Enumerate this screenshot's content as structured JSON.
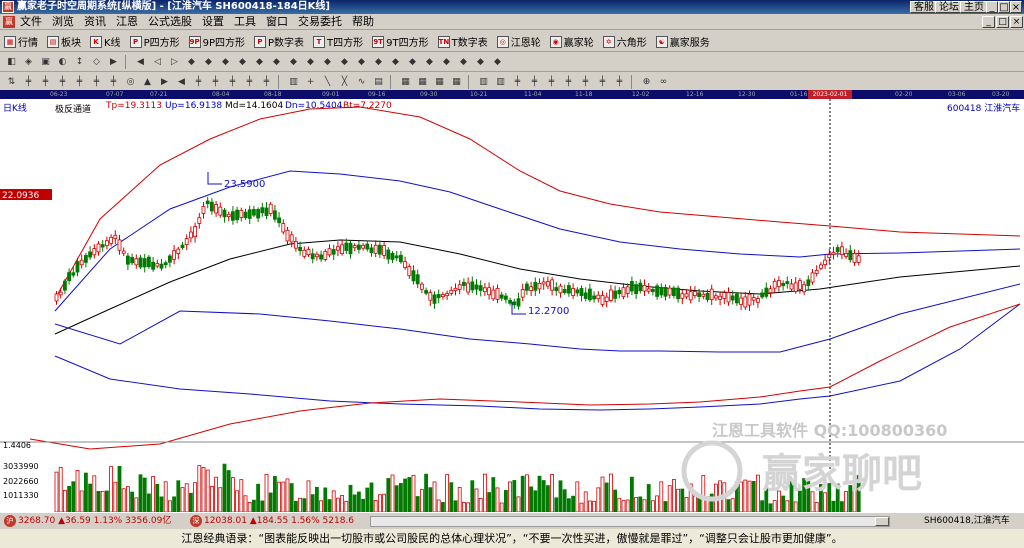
{
  "window": {
    "title": "赢家老子时空周期系统[纵横版] - [江淮汽车  SH600418-184日K线]",
    "app_icon": "赢",
    "right_links": [
      "客服",
      "论坛",
      "主页"
    ],
    "controls": [
      "_",
      "□",
      "×"
    ]
  },
  "menu": {
    "icon": "赢",
    "items": [
      "文件",
      "浏览",
      "资讯",
      "江恩",
      "公式选股",
      "设置",
      "工具",
      "窗口",
      "交易委托",
      "帮助"
    ],
    "window_controls": [
      "_",
      "□",
      "×"
    ]
  },
  "toolbar": {
    "items": [
      {
        "icon": "grid-icon",
        "glyph": "▦",
        "label": "行情"
      },
      {
        "icon": "blocks-icon",
        "glyph": "▤",
        "label": "板块"
      },
      {
        "icon": "kline-icon",
        "glyph": "K",
        "label": "K线"
      },
      {
        "icon": "p-square-icon",
        "glyph": "P",
        "label": "P四方形"
      },
      {
        "icon": "9p-square-icon",
        "glyph": "9P",
        "label": "9P四方形"
      },
      {
        "icon": "p-numtable-icon",
        "glyph": "P",
        "label": "P数字表"
      },
      {
        "icon": "t-square-icon",
        "glyph": "T",
        "label": "T四方形"
      },
      {
        "icon": "9t-square-icon",
        "glyph": "9T",
        "label": "9T四方形"
      },
      {
        "icon": "t-numtable-icon",
        "glyph": "TN",
        "label": "T数字表"
      },
      {
        "icon": "gann-wheel-icon",
        "glyph": "◎",
        "label": "江恩轮"
      },
      {
        "icon": "winner-wheel-icon",
        "glyph": "◉",
        "label": "赢家轮"
      },
      {
        "icon": "hexagon-icon",
        "glyph": "✡",
        "label": "六角形"
      },
      {
        "icon": "service-icon",
        "glyph": "☯",
        "label": "赢家服务"
      }
    ]
  },
  "chart": {
    "period_label": "日K线",
    "indicator": "极反通道",
    "tp": "Tp=19.3113",
    "up": "Up=16.9138",
    "md": "Md=14.1604",
    "dn": "Dn=10.5404",
    "bt": "Bt=7.2270",
    "stock": "600418  江淮汽车",
    "price_marker": "22.0936",
    "cursor_date": "2023-02-01",
    "high_label": "23.5900",
    "low_label": "12.2700",
    "vol_labels": [
      "1.4406",
      "3033990",
      "2022660",
      "1011330"
    ],
    "watermark_text": "江恩工具软件  QQ:100800360",
    "watermark_brand": "赢家聊吧",
    "date_ticks": [
      "06-23",
      "07-07",
      "07-21",
      "08-04",
      "08-18",
      "09-01",
      "09-16",
      "09-30",
      "10-21",
      "11-04",
      "11-18",
      "12-02",
      "12-16",
      "12-30",
      "01-16",
      "02-20",
      "03-06",
      "03-20"
    ],
    "colors": {
      "up": "#d40000",
      "down": "#007a00",
      "outer": "#d40000",
      "mid_band": "#1010c8",
      "center": "#000000"
    }
  },
  "status": {
    "sh_badge": "沪",
    "sh_quote": "3268.70 ▲36.59 1.13% 3356.09亿",
    "sz_badge": "深",
    "sz_quote": "12038.01 ▲184.55 1.56% 5218.6",
    "right": "SH600418,江淮汽车"
  },
  "quote_text": "江恩经典语录：“图表能反映出一切股市或公司股民的总体心理状况”，“不要一次性买进，傲慢就是罪过”，“调整只会让股市更加健康”。"
}
